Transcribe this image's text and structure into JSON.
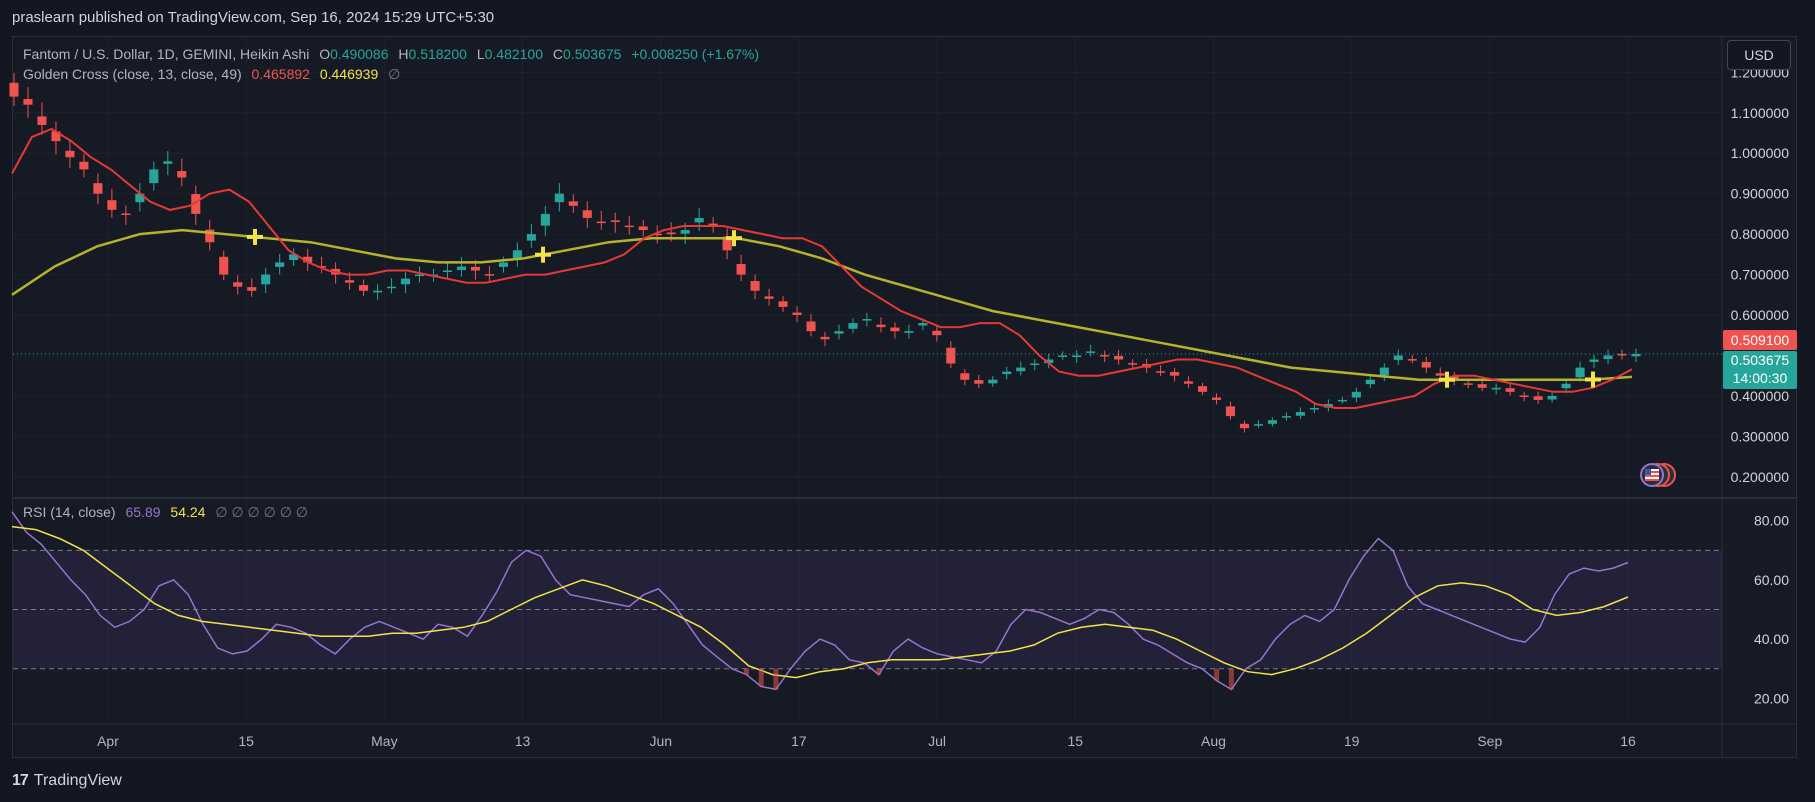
{
  "publisher_line": "praslearn published on TradingView.com, Sep 16, 2024 15:29 UTC+5:30",
  "legend": {
    "symbol": "Fantom / U.S. Dollar, 1D, GEMINI, Heikin Ashi",
    "o_label": "O",
    "o": "0.490086",
    "h_label": "H",
    "h": "0.518200",
    "l_label": "L",
    "l": "0.482100",
    "c_label": "C",
    "c": "0.503675",
    "change": "+0.008250 (+1.67%)",
    "indicator": "Golden Cross (close, 13, close, 49)",
    "fast_value": "0.465892",
    "slow_value": "0.446939",
    "null_marker": "∅",
    "rsi_label": "RSI (14, close)",
    "rsi_value": "65.89",
    "rsi_ma_value": "54.24",
    "rsi_nulls": "∅ ∅ ∅ ∅ ∅ ∅"
  },
  "currency_button": "USD",
  "price_tags": {
    "red_tag": "0.509100",
    "last_price": "0.503675",
    "countdown": "14:00:30"
  },
  "colors": {
    "up": "#26a69a",
    "down": "#ef5350",
    "fast_ma": "#e53935",
    "slow_ma": "#b5b32b",
    "rsi": "#9575cd",
    "rsi_ma": "#f2e34c",
    "background": "#131722"
  },
  "footer": {
    "logo": "17",
    "brand": "TradingView"
  },
  "chart_data": [
    {
      "type": "candlestick",
      "style": "heikin-ashi",
      "title": "Fantom / U.S. Dollar, 1D, GEMINI, Heikin Ashi",
      "y_ticks": [
        "1.200000",
        "1.100000",
        "1.000000",
        "0.900000",
        "0.800000",
        "0.700000",
        "0.600000",
        "0.400000",
        "0.300000",
        "0.200000"
      ],
      "ylim": [
        0.15,
        1.28
      ],
      "x_ticks": [
        "Apr",
        "15",
        "May",
        "13",
        "Jun",
        "17",
        "Jul",
        "15",
        "Aug",
        "19",
        "Sep",
        "16"
      ],
      "close_series": [
        1.14,
        1.12,
        1.07,
        1.03,
        0.99,
        0.96,
        0.9,
        0.86,
        0.85,
        0.9,
        0.96,
        0.98,
        0.94,
        0.85,
        0.78,
        0.7,
        0.67,
        0.66,
        0.7,
        0.73,
        0.75,
        0.73,
        0.72,
        0.7,
        0.68,
        0.66,
        0.66,
        0.67,
        0.69,
        0.7,
        0.7,
        0.71,
        0.72,
        0.71,
        0.7,
        0.73,
        0.76,
        0.8,
        0.85,
        0.9,
        0.87,
        0.84,
        0.83,
        0.83,
        0.82,
        0.81,
        0.8,
        0.8,
        0.81,
        0.84,
        0.82,
        0.76,
        0.7,
        0.66,
        0.64,
        0.62,
        0.6,
        0.56,
        0.54,
        0.56,
        0.58,
        0.59,
        0.57,
        0.56,
        0.56,
        0.58,
        0.55,
        0.48,
        0.44,
        0.43,
        0.44,
        0.46,
        0.47,
        0.48,
        0.49,
        0.5,
        0.5,
        0.51,
        0.5,
        0.49,
        0.48,
        0.47,
        0.46,
        0.45,
        0.43,
        0.41,
        0.39,
        0.35,
        0.32,
        0.33,
        0.34,
        0.35,
        0.36,
        0.37,
        0.38,
        0.39,
        0.41,
        0.44,
        0.47,
        0.5,
        0.49,
        0.47,
        0.45,
        0.44,
        0.43,
        0.42,
        0.42,
        0.41,
        0.4,
        0.39,
        0.4,
        0.43,
        0.47,
        0.49,
        0.5,
        0.5,
        0.5037
      ],
      "series": [
        {
          "name": "Golden Cross 13",
          "values": [
            0.95,
            1.04,
            1.06,
            1.03,
            0.99,
            0.96,
            0.92,
            0.88,
            0.86,
            0.87,
            0.9,
            0.91,
            0.88,
            0.82,
            0.76,
            0.73,
            0.71,
            0.7,
            0.7,
            0.71,
            0.71,
            0.7,
            0.69,
            0.68,
            0.68,
            0.69,
            0.7,
            0.7,
            0.71,
            0.72,
            0.73,
            0.75,
            0.79,
            0.81,
            0.82,
            0.82,
            0.82,
            0.81,
            0.8,
            0.79,
            0.79,
            0.77,
            0.72,
            0.67,
            0.64,
            0.61,
            0.59,
            0.57,
            0.57,
            0.58,
            0.58,
            0.55,
            0.5,
            0.46,
            0.45,
            0.45,
            0.46,
            0.47,
            0.48,
            0.49,
            0.49,
            0.48,
            0.47,
            0.45,
            0.43,
            0.41,
            0.38,
            0.37,
            0.37,
            0.38,
            0.39,
            0.4,
            0.43,
            0.45,
            0.45,
            0.44,
            0.43,
            0.42,
            0.41,
            0.41,
            0.42,
            0.44,
            0.4659
          ]
        },
        {
          "name": "Golden Cross 49",
          "values": [
            0.65,
            0.72,
            0.77,
            0.8,
            0.81,
            0.8,
            0.79,
            0.78,
            0.76,
            0.74,
            0.73,
            0.73,
            0.74,
            0.76,
            0.78,
            0.79,
            0.79,
            0.79,
            0.77,
            0.74,
            0.7,
            0.67,
            0.64,
            0.61,
            0.59,
            0.57,
            0.55,
            0.53,
            0.51,
            0.49,
            0.47,
            0.46,
            0.45,
            0.44,
            0.44,
            0.44,
            0.44,
            0.44,
            0.4469
          ]
        }
      ]
    },
    {
      "type": "line",
      "title": "RSI (14, close)",
      "y_ticks": [
        "80.00",
        "60.00",
        "40.00",
        "20.00"
      ],
      "ylim": [
        12,
        87
      ],
      "bands": [
        30,
        50,
        70
      ],
      "series": [
        {
          "name": "RSI",
          "values": [
            83,
            76,
            72,
            66,
            60,
            55,
            48,
            44,
            46,
            50,
            58,
            60,
            55,
            45,
            37,
            35,
            36,
            40,
            45,
            44,
            42,
            38,
            35,
            40,
            44,
            46,
            44,
            42,
            40,
            45,
            44,
            41,
            48,
            56,
            66,
            70,
            68,
            60,
            55,
            54,
            53,
            52,
            51,
            55,
            57,
            52,
            45,
            38,
            34,
            30,
            28,
            24,
            23,
            30,
            36,
            40,
            38,
            33,
            32,
            28,
            36,
            40,
            37,
            35,
            34,
            33,
            32,
            36,
            45,
            50,
            49,
            47,
            45,
            47,
            50,
            49,
            45,
            40,
            38,
            35,
            32,
            30,
            26,
            23,
            30,
            33,
            40,
            45,
            48,
            46,
            50,
            60,
            68,
            74,
            70,
            58,
            52,
            50,
            48,
            46,
            44,
            42,
            40,
            39,
            44,
            55,
            62,
            64,
            63,
            64,
            65.89
          ]
        },
        {
          "name": "RSI MA",
          "values": [
            78,
            77,
            74,
            70,
            64,
            58,
            52,
            48,
            46,
            45,
            44,
            43,
            42,
            41,
            41,
            41,
            42,
            42,
            43,
            44,
            46,
            50,
            54,
            57,
            60,
            58,
            55,
            52,
            48,
            44,
            38,
            31,
            28,
            27,
            29,
            30,
            32,
            33,
            33,
            33,
            34,
            35,
            36,
            38,
            42,
            44,
            45,
            44,
            43,
            40,
            36,
            32,
            29,
            28,
            30,
            33,
            37,
            42,
            48,
            54,
            58,
            59,
            58,
            55,
            50,
            48,
            49,
            51,
            54.24
          ]
        }
      ]
    }
  ]
}
